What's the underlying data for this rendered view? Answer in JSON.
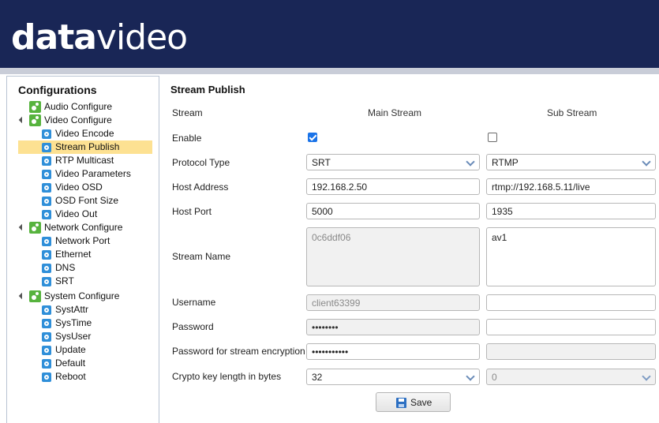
{
  "header": {
    "logo_bold": "data",
    "logo_light": "video"
  },
  "sidebar": {
    "title": "Configurations",
    "groups": [
      {
        "label": "Audio Configure",
        "items": []
      },
      {
        "label": "Video Configure",
        "items": [
          "Video Encode",
          "Stream Publish",
          "RTP Multicast",
          "Video Parameters",
          "Video OSD",
          "OSD Font Size",
          "Video Out"
        ]
      },
      {
        "label": "Network Configure",
        "items": [
          "Network Port",
          "Ethernet",
          "DNS",
          "SRT"
        ]
      },
      {
        "label": "System Configure",
        "items": [
          "SystAttr",
          "SysTime",
          "SysUser",
          "Update",
          "Default",
          "Reboot"
        ]
      }
    ],
    "selected": "Stream Publish"
  },
  "panel": {
    "title": "Stream Publish",
    "columns": {
      "label": "Stream",
      "main": "Main Stream",
      "sub": "Sub Stream"
    },
    "labels": {
      "enable": "Enable",
      "protocol": "Protocol Type",
      "host_address": "Host Address",
      "host_port": "Host Port",
      "stream_name": "Stream Name",
      "username": "Username",
      "password": "Password",
      "stream_password": "Password for stream encryption",
      "crypto": "Crypto key length in bytes"
    },
    "main": {
      "enable": true,
      "protocol": "SRT",
      "host_address": "192.168.2.50",
      "host_port": "5000",
      "stream_name": "0c6ddf06",
      "username": "client63399",
      "password": "••••••••",
      "stream_password": "•••••••••••",
      "crypto": "32"
    },
    "sub": {
      "enable": false,
      "protocol": "RTMP",
      "host_address": "rtmp://192.168.5.11/live",
      "host_port": "1935",
      "stream_name": "av1",
      "username": "",
      "password": "",
      "stream_password": "",
      "crypto": "0"
    },
    "save_label": "Save"
  },
  "icons": {
    "group": "gear-group-icon",
    "leaf": "gear-leaf-icon",
    "save": "floppy-disk-icon"
  },
  "colors": {
    "header_bg": "#192656",
    "selected_bg": "#fde192",
    "checkbox_checked": "#1a73e8"
  }
}
